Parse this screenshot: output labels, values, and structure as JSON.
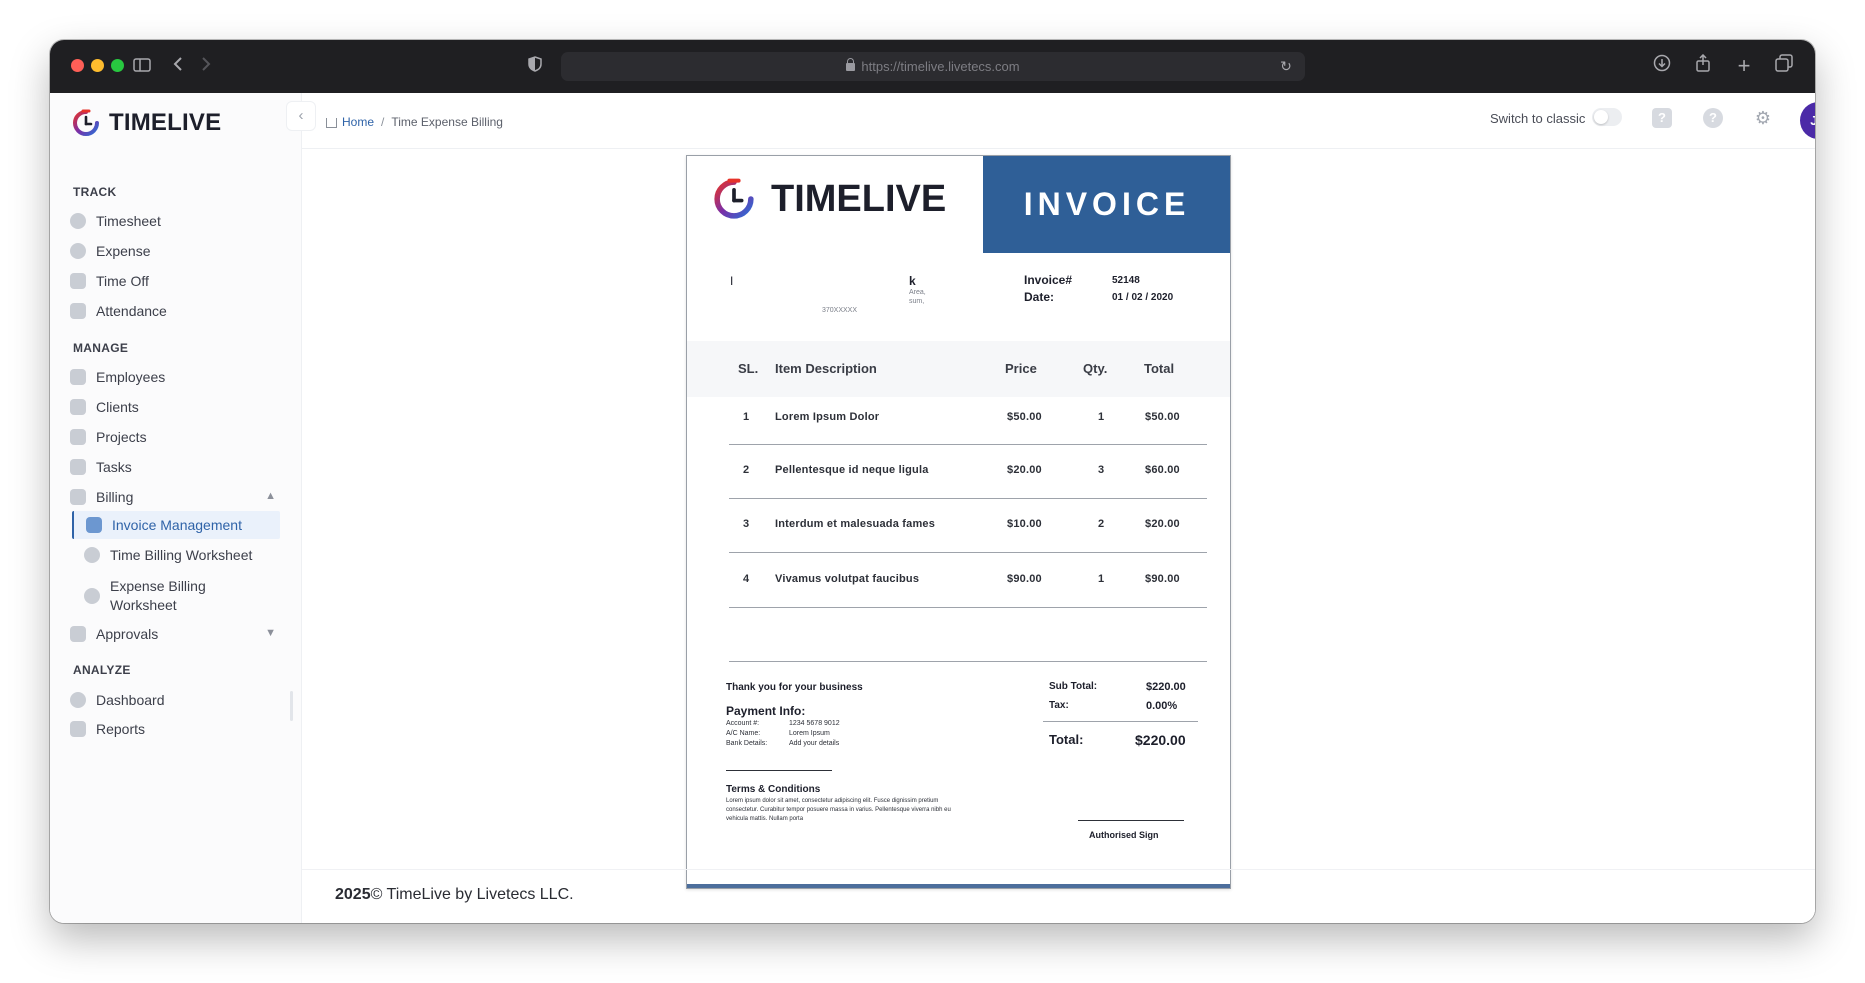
{
  "browser": {
    "url": "https://timelive.livetecs.com"
  },
  "app": {
    "brand": "TIMELIVE"
  },
  "sidebar": {
    "sections": [
      {
        "title": "TRACK",
        "items": [
          "Timesheet",
          "Expense",
          "Time Off",
          "Attendance"
        ]
      },
      {
        "title": "MANAGE",
        "items": [
          "Employees",
          "Clients",
          "Projects",
          "Tasks",
          "Billing"
        ]
      },
      {
        "title": "ANALYZE",
        "items": [
          "Dashboard",
          "Reports"
        ]
      }
    ],
    "billing_sub": [
      "Invoice Management",
      "Time Billing Worksheet",
      "Expense Billing Worksheet"
    ],
    "approvals": "Approvals"
  },
  "header": {
    "breadcrumb_home": "Home",
    "breadcrumb_sep": "/",
    "breadcrumb_current": "Time Expense Billing",
    "switch_label": "Switch to classic",
    "avatar_initials": "JD"
  },
  "invoice": {
    "brand": "TIMELIVE",
    "banner": "INVOICE",
    "invoice_no_label": "Invoice#",
    "invoice_no": "52148",
    "date_label": "Date:",
    "date": "01 / 02 / 2020",
    "address_fragments": [
      "I",
      "k",
      "Area,",
      "sum,",
      "370XXXXX"
    ],
    "columns": [
      "SL.",
      "Item Description",
      "Price",
      "Qty.",
      "Total"
    ],
    "rows": [
      {
        "sl": "1",
        "desc": "Lorem Ipsum Dolor",
        "price": "$50.00",
        "qty": "1",
        "total": "$50.00"
      },
      {
        "sl": "2",
        "desc": "Pellentesque id neque ligula",
        "price": "$20.00",
        "qty": "3",
        "total": "$60.00"
      },
      {
        "sl": "3",
        "desc": "Interdum et malesuada fames",
        "price": "$10.00",
        "qty": "2",
        "total": "$20.00"
      },
      {
        "sl": "4",
        "desc": "Vivamus volutpat faucibus",
        "price": "$90.00",
        "qty": "1",
        "total": "$90.00"
      }
    ],
    "thanks": "Thank you for your business",
    "payment_title": "Payment Info:",
    "payment": [
      {
        "label": "Account #:",
        "value": "1234 5678 9012"
      },
      {
        "label": "A/C Name:",
        "value": "Lorem Ipsum"
      },
      {
        "label": "Bank Details:",
        "value": "Add your details"
      }
    ],
    "subtotal_label": "Sub Total:",
    "subtotal": "$220.00",
    "tax_label": "Tax:",
    "tax": "0.00%",
    "total_label": "Total:",
    "total": "$220.00",
    "terms_title": "Terms & Conditions",
    "terms_text": "Lorem ipsum dolor sit amet, consectetur adipiscing elit. Fusce dignissim pretium consectetur. Curabitur tempor posuere massa in varius. Pellentesque viverra nibh eu vehicula mattis. Nullam porta",
    "sign": "Authorised Sign"
  },
  "footer": {
    "year": "2025",
    "text": "© TimeLive by Livetecs LLC."
  },
  "colors": {
    "banner": "#2f5f97",
    "accent": "#2f63a8",
    "avatar": "#4b2aa7"
  }
}
